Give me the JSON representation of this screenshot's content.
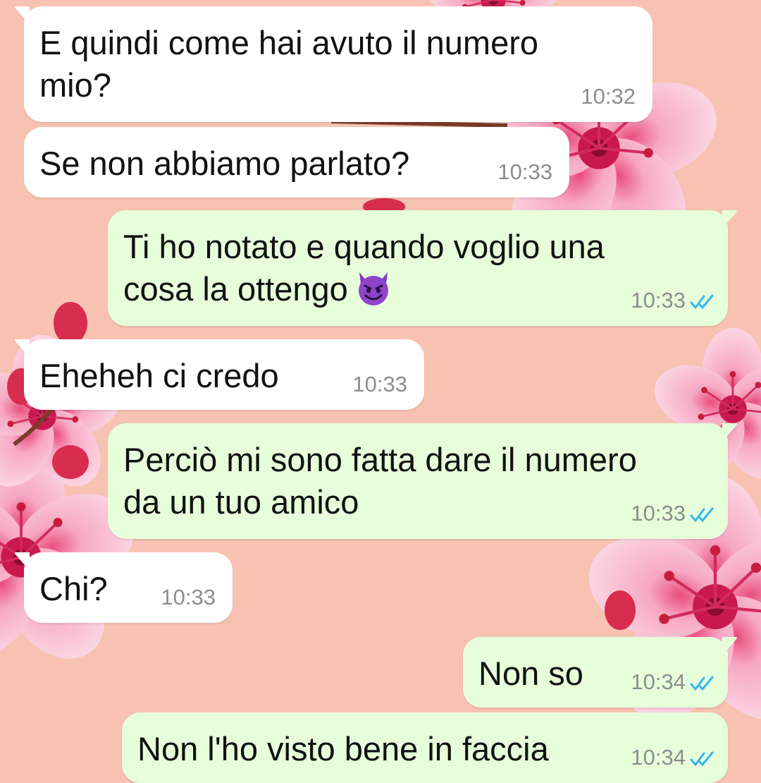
{
  "colors": {
    "background": "#f7c2b1",
    "incoming_bubble": "#ffffff",
    "outgoing_bubble": "#e6ffda",
    "read_ticks": "#34b7f1"
  },
  "messages": [
    {
      "direction": "incoming",
      "text": "E quindi come hai avuto il numero\nmio?",
      "time": "10:32"
    },
    {
      "direction": "incoming",
      "text": "Se non abbiamo parlato?",
      "time": "10:33"
    },
    {
      "direction": "outgoing",
      "text": "Ti ho notato e quando voglio una\ncosa la ottengo",
      "emoji": "smiling-devil-icon",
      "time": "10:33",
      "status": "read"
    },
    {
      "direction": "incoming",
      "text": "Eheheh ci credo",
      "time": "10:33"
    },
    {
      "direction": "outgoing",
      "text": "Perciò mi sono fatta dare il numero\nda un tuo amico",
      "time": "10:33",
      "status": "read"
    },
    {
      "direction": "incoming",
      "text": "Chi?",
      "time": "10:33"
    },
    {
      "direction": "outgoing",
      "text": "Non so",
      "time": "10:34",
      "status": "read"
    },
    {
      "direction": "outgoing",
      "text": "Non l'ho visto bene in faccia",
      "time": "10:34",
      "status": "read"
    }
  ]
}
